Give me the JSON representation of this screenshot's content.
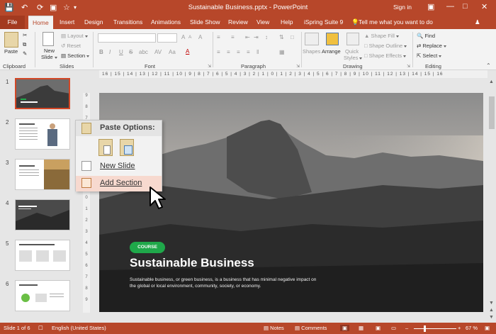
{
  "window": {
    "title": "Sustainable Business.pptx - PowerPoint",
    "sign_in": "Sign in"
  },
  "tabs": [
    "File",
    "Home",
    "Insert",
    "Design",
    "Transitions",
    "Animations",
    "Slide Show",
    "Review",
    "View",
    "Help",
    "iSpring Suite 9"
  ],
  "tell_me": "Tell me what you want to do",
  "ribbon": {
    "clipboard": {
      "paste": "Paste",
      "label": "Clipboard"
    },
    "slides": {
      "new_slide": "New",
      "new_slide2": "Slide",
      "layout": "Layout",
      "reset": "Reset",
      "section": "Section",
      "label": "Slides"
    },
    "font": {
      "label": "Font",
      "bold": "B",
      "italic": "I",
      "underline": "U",
      "strike": "S",
      "shadow": "abc",
      "spacing": "AV",
      "case": "Aa",
      "color": "A",
      "grow": "A",
      "shrink": "A",
      "clear": "A"
    },
    "paragraph": {
      "label": "Paragraph"
    },
    "drawing": {
      "shapes": "Shapes",
      "arrange": "Arrange",
      "quick_styles": "Quick",
      "quick_styles2": "Styles",
      "shape_fill": "Shape Fill",
      "shape_outline": "Shape Outline",
      "shape_effects": "Shape Effects",
      "label": "Drawing"
    },
    "editing": {
      "find": "Find",
      "replace": "Replace",
      "select": "Select",
      "label": "Editing"
    }
  },
  "ruler": {
    "horizontal": "16 | 15 | 14 | 13 | 12 | 11 | 10 | 9 | 8 | 7 | 6 | 5 | 4 | 3 | 2 | 1 | 0 | 1 | 2 | 3 | 4 | 5 | 6 | 7 | 8 | 9 | 10 | 11 | 12 | 13 | 14 | 15 | 16",
    "vertical": [
      "9",
      "8",
      "7",
      "6",
      "5",
      "4",
      "3",
      "2",
      "1",
      "0",
      "1",
      "2",
      "3",
      "4",
      "5",
      "6",
      "7",
      "8",
      "9"
    ]
  },
  "thumbnails": [
    {
      "num": "1"
    },
    {
      "num": "2"
    },
    {
      "num": "3"
    },
    {
      "num": "4"
    },
    {
      "num": "5"
    },
    {
      "num": "6"
    }
  ],
  "slide": {
    "badge": "COURSE",
    "title": "Sustainable Business",
    "body": "Sustainable business, or green business, is a business that has minimal negative impact on the global or local environment, community, society, or economy."
  },
  "context_menu": {
    "header": "Paste Options:",
    "items": [
      "New Slide",
      "Add Section"
    ]
  },
  "status": {
    "slide": "Slide 1 of 6",
    "language": "English (United States)",
    "notes": "Notes",
    "comments": "Comments",
    "zoom": "67 %"
  },
  "colors": {
    "accent": "#b7472a",
    "highlight": "#f7d9cf",
    "badge": "#1fa84a"
  }
}
